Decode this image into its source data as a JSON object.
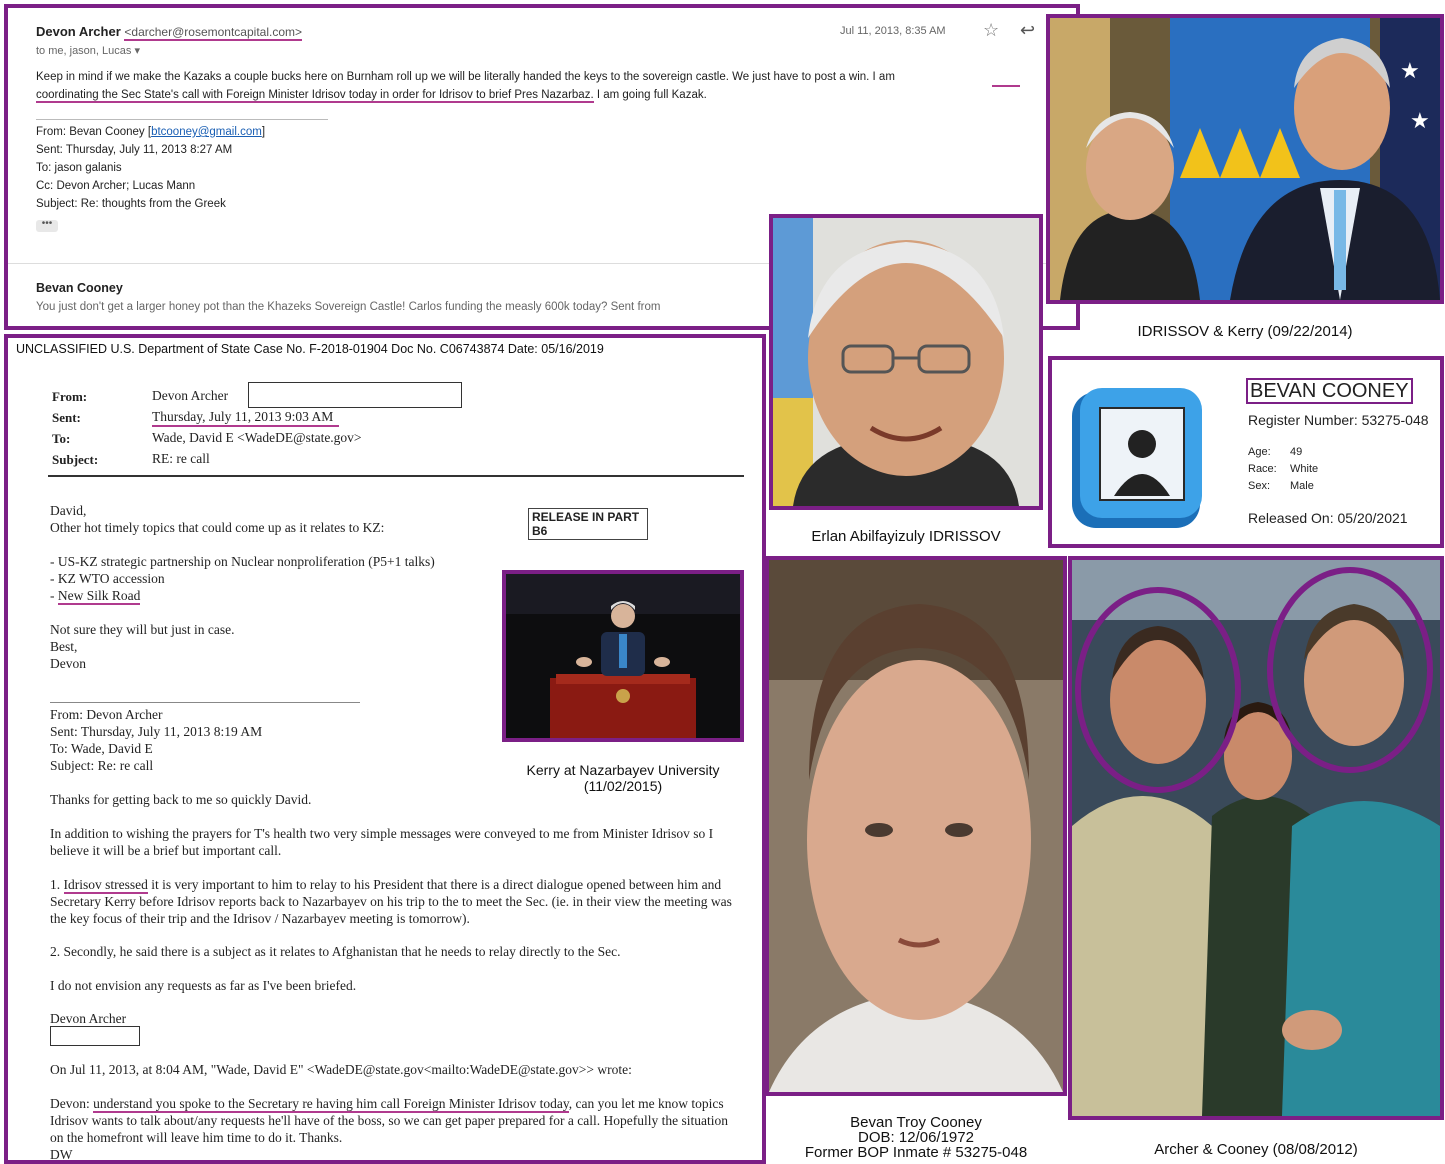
{
  "email1": {
    "sender_name": "Devon Archer",
    "sender_email": "<darcher@rosemontcapital.com>",
    "recipients": "to me, jason, Lucas",
    "date": "Jul 11, 2013, 8:35 AM",
    "body_line1": "Keep in mind if we make the Kazaks a couple bucks here on Burnham roll up we will be literally handed the keys to the sovereign castle.  We just have to post a win.  I am",
    "body_line2a": "coordinating the Sec State's call with Foreign Minister Idrisov today in order for Idrisov to brief Pres Nazarbaz.",
    "body_line2b": " I am going full Kazak.",
    "from_label": "From: Bevan Cooney [",
    "from_email": "btcooney@gmail.com",
    "sent": "Sent: Thursday, July 11, 2013 8:27 AM",
    "to": "To: jason galanis",
    "cc": "Cc: Devon Archer; Lucas Mann",
    "subject": "Subject: Re: thoughts from the Greek",
    "dots": "•••",
    "snippet_name": "Bevan Cooney",
    "snippet_text_a": "You just don't get a larger honey pot than the Khazeks Sovereign Castle!",
    "snippet_text_b": " Carlos funding the measly 600k today? Sent from"
  },
  "doc": {
    "banner": "UNCLASSIFIED  U.S. Department of State  Case No. F-2018-01904  Doc No. C06743874  Date: 05/16/2019",
    "from_label": "From:",
    "from_value": "Devon Archer",
    "sent_label": "Sent:",
    "sent_value": "Thursday, July 11, 2013 9:03 AM",
    "to_label": "To:",
    "to_value": "Wade, David E <WadeDE@state.gov>",
    "subject_label": "Subject:",
    "subject_value": "RE: re call",
    "release_line1": "RELEASE IN PART",
    "release_line2": "B6",
    "salutation": "David,",
    "intro": "Other hot timely topics that could come up as it relates to KZ:",
    "bullet1": "- US-KZ strategic partnership on Nuclear nonproliferation (P5+1 talks)",
    "bullet2": "- KZ WTO accession",
    "bullet3_dash": "- ",
    "bullet3": "New Silk Road",
    "close1": "Not sure they will but just in case.",
    "close2": "Best,",
    "close3": "Devon",
    "q_from": "From: Devon Archer",
    "q_sent": "Sent: Thursday, July 11, 2013 8:19 AM",
    "q_to": "To: Wade, David E",
    "q_subject": "Subject: Re: re call",
    "q_thanks": "Thanks for getting back to me so quickly David.",
    "q_p1": "In addition to wishing the prayers for T's health two very simple messages were conveyed to me from Minister Idrisov so I believe it will be a brief but important call.",
    "q_p2_u": "Idrisov stressed",
    "q_p2_pre": "1. ",
    "q_p2": " it is very important to him to relay to his President that there is a direct dialogue opened between him and Secretary Kerry before Idrisov reports back to Nazarbayev on his trip to the to meet the Sec. (ie. in their view the meeting was the key focus of their trip and the Idrisov / Nazarbayev meeting is tomorrow).",
    "q_p3": "2. Secondly, he said there is a subject as it relates to Afghanistan that he needs to relay directly to the Sec.",
    "q_p4": "I do not envision any requests as far as I've been briefed.",
    "q_sig": "Devon Archer",
    "q_wrote": "On Jul 11, 2013, at 8:04 AM, \"Wade, David E\" <WadeDE@state.gov<mailto:WadeDE@state.gov>> wrote:",
    "q_devon_pre": "Devon: ",
    "q_devon_u": "understand you spoke to the Secretary re having him call Foreign Minister Idrisov today",
    "q_devon": ", can you let me know topics Idrisov wants to talk about/any requests he'll have of the boss, so we can get paper prepared for a call. Hopefully the situation on the homefront will leave him time to do it. Thanks.",
    "q_dw": "DW",
    "kerry_caption_1": "Kerry at Nazarbayev University",
    "kerry_caption_2": "(11/02/2015)"
  },
  "captions": {
    "idrissov_kerry": "IDRISSOV & Kerry (09/22/2014)",
    "idrissov": "Erlan Abilfayizuly IDRISSOV",
    "cooney_1": "Bevan Troy Cooney",
    "cooney_2": "DOB: 12/06/1972",
    "cooney_3": "Former BOP Inmate # 53275-048",
    "archer_cooney": "Archer & Cooney (08/08/2012)"
  },
  "bop": {
    "name": "BEVAN COONEY",
    "register": "Register Number: 53275-048",
    "age_label": "Age:",
    "age": "49",
    "race_label": "Race:",
    "race": "White",
    "sex_label": "Sex:",
    "sex": "Male",
    "released": "Released On: 05/20/2021"
  },
  "colors": {
    "frame": "#7b1f86",
    "underline": "#b03a8e",
    "link": "#1a5fb4"
  }
}
